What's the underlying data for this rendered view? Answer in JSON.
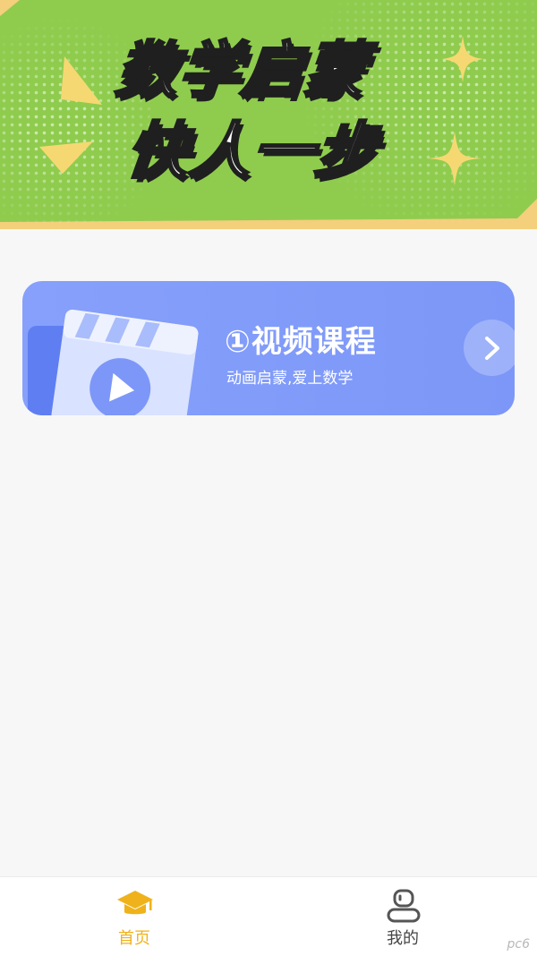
{
  "banner": {
    "line1": "数学启蒙",
    "line2": "快人一步"
  },
  "course_card": {
    "title": "①视频课程",
    "subtitle": "动画启蒙,爱上数学",
    "icon": "chevron-right-icon"
  },
  "tabbar": {
    "tabs": [
      {
        "label": "首页",
        "icon": "graduation-cap-icon",
        "active": true
      },
      {
        "label": "我的",
        "icon": "robot-profile-icon",
        "active": false
      }
    ]
  },
  "watermark": "pc6",
  "colors": {
    "banner_green": "#8fcc4e",
    "banner_yellow": "#f4cf7c",
    "card_blue": "#7d97f8",
    "active_tab": "#f0b21a",
    "inactive_tab": "#444444",
    "background": "#f7f7f8"
  }
}
